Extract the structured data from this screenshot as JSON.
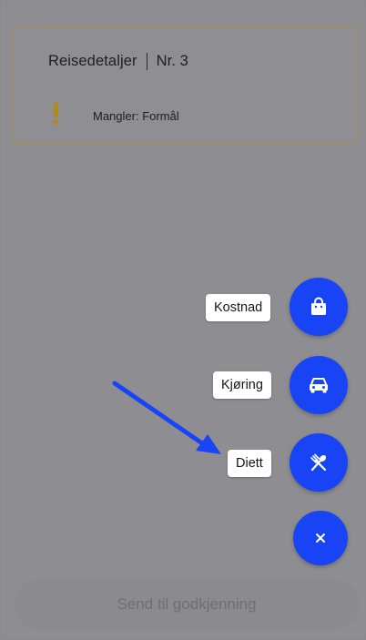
{
  "card": {
    "title": "Reisedetaljer",
    "number": "Nr. 3",
    "warning": "Mangler: Formål",
    "warning_icon": "exclamation-icon",
    "accent_color": "#b08a1a"
  },
  "fab_menu": {
    "accent_color": "#1944f5",
    "items": [
      {
        "label": "Kostnad",
        "icon": "shopping-bag-icon"
      },
      {
        "label": "Kjøring",
        "icon": "car-icon"
      },
      {
        "label": "Diett",
        "icon": "fork-spoon-icon"
      }
    ],
    "close_icon": "close-icon"
  },
  "footer": {
    "send_label": "Send til godkjenning"
  }
}
